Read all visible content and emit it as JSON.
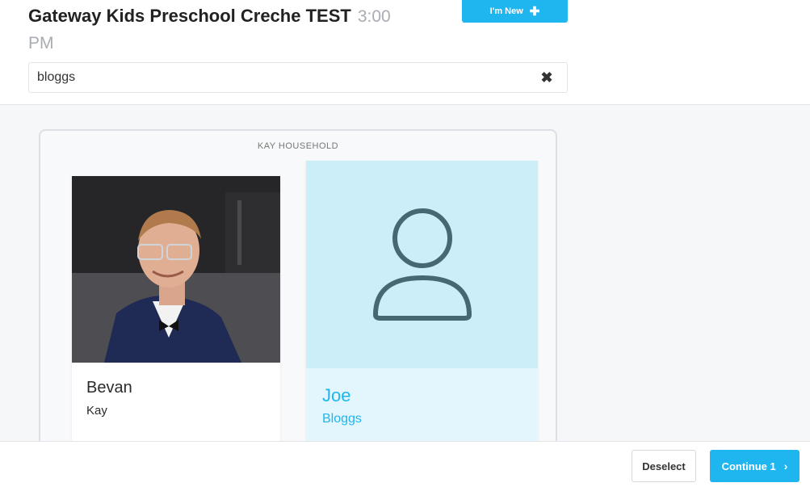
{
  "header": {
    "title": "Gateway Kids Preschool Creche TEST",
    "time": "3:00 PM",
    "new_button_label": "I'm New",
    "new_button_icon": "plus-icon"
  },
  "search": {
    "value": "bloggs",
    "clear_icon": "close-icon"
  },
  "household": {
    "label": "KAY HOUSEHOLD",
    "people": [
      {
        "first_name": "Bevan",
        "last_name": "Kay",
        "selected": false,
        "has_photo": true
      },
      {
        "first_name": "Joe",
        "last_name": "Bloggs",
        "selected": true,
        "has_photo": false
      }
    ]
  },
  "footer": {
    "deselect_label": "Deselect",
    "continue_label": "Continue 1",
    "continue_icon": "chevron-right-icon"
  },
  "colors": {
    "accent": "#1fb6f0",
    "selected_card_bg": "#e3f6fd",
    "avatar_bg": "#cbeef9",
    "avatar_stroke": "#456872"
  }
}
